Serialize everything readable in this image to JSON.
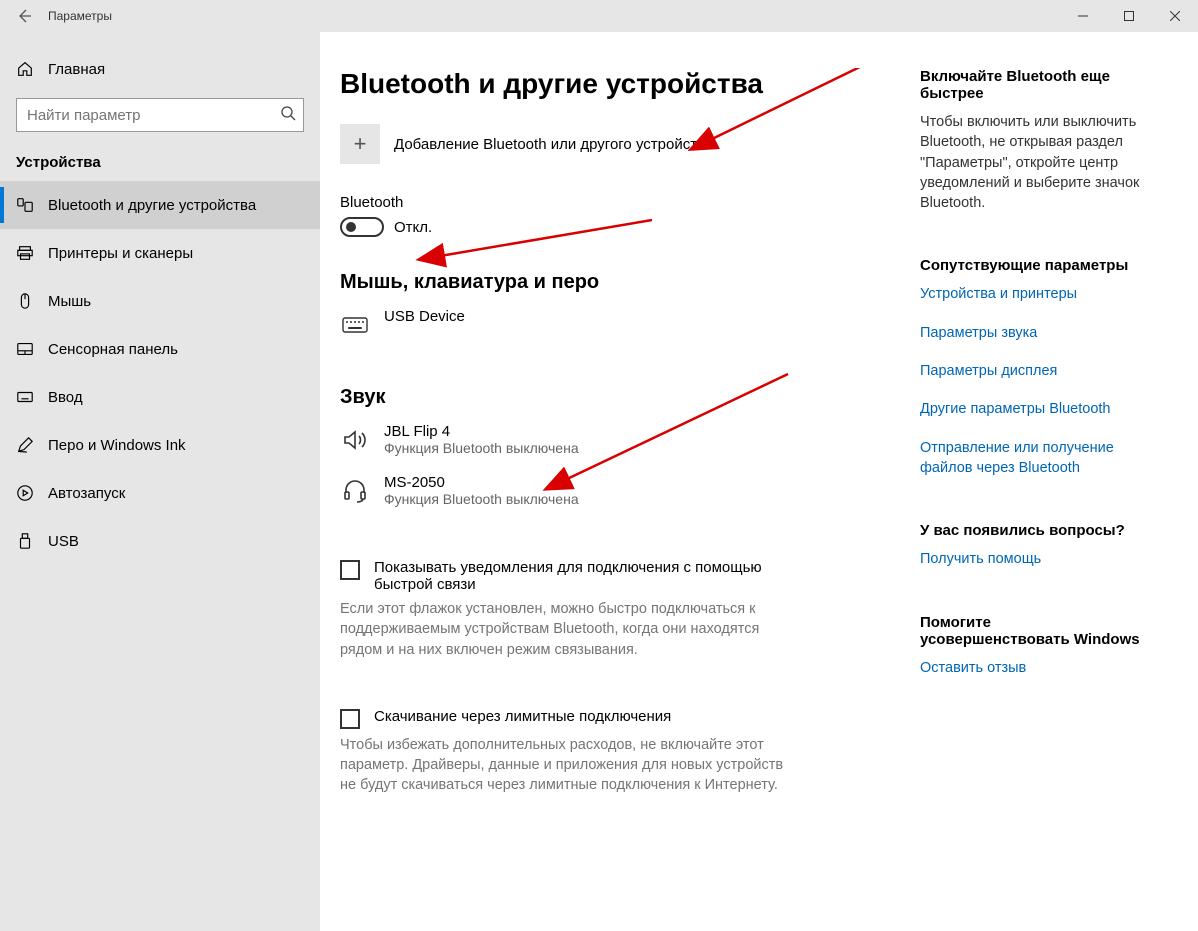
{
  "window": {
    "title": "Параметры"
  },
  "sidebar": {
    "home": "Главная",
    "search_placeholder": "Найти параметр",
    "section": "Устройства",
    "items": [
      {
        "label": "Bluetooth и другие устройства"
      },
      {
        "label": "Принтеры и сканеры"
      },
      {
        "label": "Мышь"
      },
      {
        "label": "Сенсорная панель"
      },
      {
        "label": "Ввод"
      },
      {
        "label": "Перо и Windows Ink"
      },
      {
        "label": "Автозапуск"
      },
      {
        "label": "USB"
      }
    ]
  },
  "main": {
    "title": "Bluetooth и другие устройства",
    "add_device": "Добавление Bluetooth или другого устройства",
    "bt_label": "Bluetooth",
    "bt_state": "Откл.",
    "sec_mkb": "Мышь, клавиатура и перо",
    "dev_usb": "USB Device",
    "sec_sound": "Звук",
    "dev_jbl": {
      "name": "JBL Flip 4",
      "sub": "Функция Bluetooth выключена"
    },
    "dev_ms": {
      "name": "MS-2050",
      "sub": "Функция Bluetooth выключена"
    },
    "chk_notif": "Показывать уведомления для подключения с помощью быстрой связи",
    "chk_notif_desc": "Если этот флажок установлен, можно быстро подключаться к поддерживаемым устройствам Bluetooth, когда они находятся рядом и на них включен режим связывания.",
    "chk_limit": "Скачивание через лимитные подключения",
    "chk_limit_desc": "Чтобы избежать дополнительных расходов, не включайте этот параметр. Драйверы, данные и приложения для новых устройств не будут скачиваться через лимитные подключения к Интернету."
  },
  "side": {
    "tip_h": "Включайте Bluetooth еще быстрее",
    "tip_p": "Чтобы включить или выключить Bluetooth, не открывая раздел \"Параметры\", откройте центр уведомлений и выберите значок Bluetooth.",
    "related_h": "Сопутствующие параметры",
    "links": [
      "Устройства и принтеры",
      "Параметры звука",
      "Параметры дисплея",
      "Другие параметры Bluetooth",
      "Отправление или получение файлов через Bluetooth"
    ],
    "help_h": "У вас появились вопросы?",
    "help_link": "Получить помощь",
    "feedback_h": "Помогите усовершенствовать Windows",
    "feedback_link": "Оставить отзыв"
  }
}
